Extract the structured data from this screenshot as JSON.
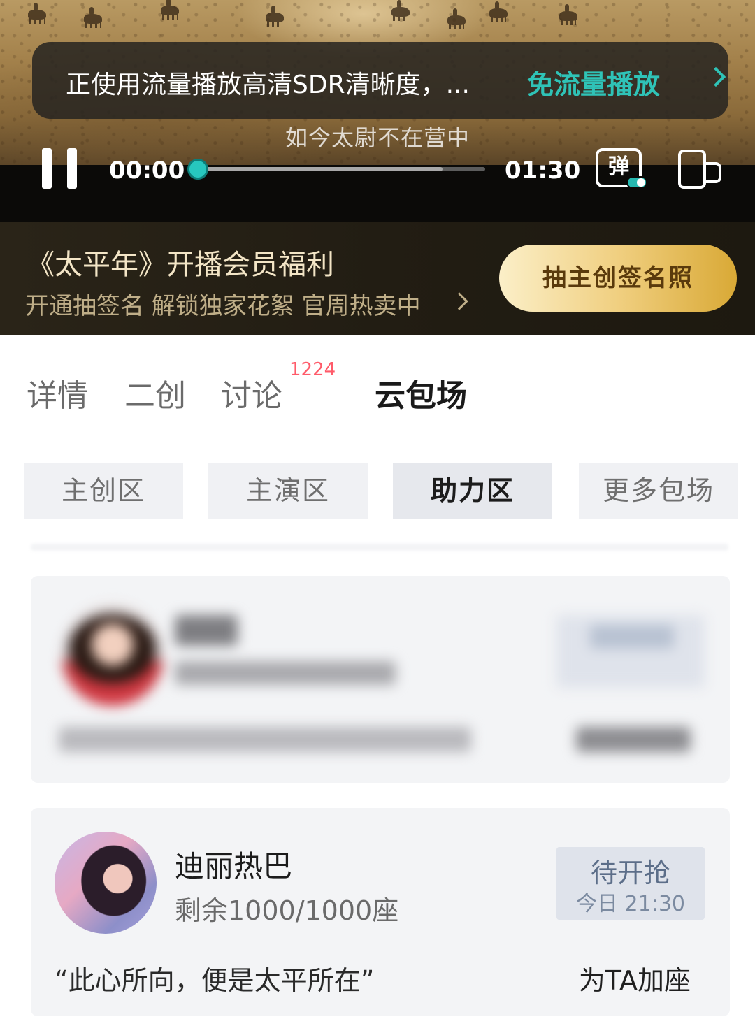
{
  "video": {
    "toast_message": "正使用流量播放高清SDR清晰度，...",
    "toast_action": "免流量播放",
    "subtitle": "如今太尉不在营中",
    "current_time": "00:00",
    "duration": "01:30",
    "progress": 0.0,
    "buffered": 0.85,
    "danmu_label": "弹",
    "accent_color": "#27c7be"
  },
  "promo": {
    "title": "《太平年》开播会员福利",
    "subtitle": "开通抽签名 解锁独家花絮 官周热卖中",
    "button_label": "抽主创签名照"
  },
  "tabs": {
    "items": [
      {
        "label": "详情"
      },
      {
        "label": "二创"
      },
      {
        "label": "讨论"
      },
      {
        "label": "云包场"
      }
    ],
    "active": "云包场",
    "discussion_badge": "1224"
  },
  "zones": {
    "items": [
      {
        "label": "主创区"
      },
      {
        "label": "主演区"
      },
      {
        "label": "助力区"
      },
      {
        "label": "更多包场"
      }
    ],
    "active": "助力区"
  },
  "cards": [
    {
      "blurred": true,
      "name": "",
      "seats": "",
      "quote": "",
      "action": "",
      "status_title": "",
      "status_time": ""
    },
    {
      "blurred": false,
      "name": "迪丽热巴",
      "seats": "剩余1000/1000座",
      "quote": "“此心所向，便是太平所在”",
      "action": "为TA加座",
      "status_title": "待开抢",
      "status_time": "今日 21:30"
    }
  ]
}
